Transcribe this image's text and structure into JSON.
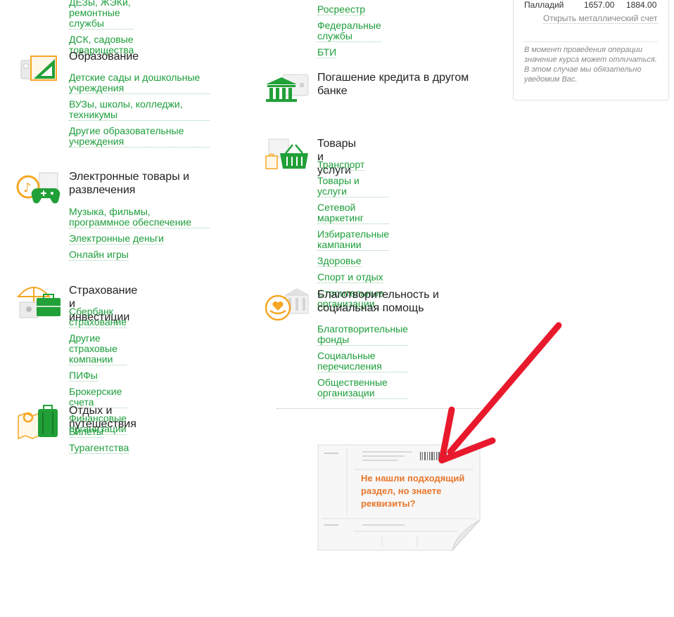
{
  "left_column": [
    {
      "title": "",
      "icon": "home-services-icon",
      "links": [
        "ДЕЗы, ЖЭКи, ремонтные службы",
        "ДСК, садовые товарищества"
      ]
    },
    {
      "title": "Образование",
      "icon": "education-icon",
      "links": [
        "Детские сады и дошкольные учреждения",
        "ВУЗы, школы, колледжи, техникумы",
        "Другие образовательные учреждения"
      ]
    },
    {
      "title": "Электронные товары и развлечения",
      "icon": "entertainment-icon",
      "links": [
        "Музыка, фильмы, программное обеспечение",
        "Электронные деньги",
        "Онлайн игры"
      ]
    },
    {
      "title": "Страхование и инвестиции",
      "icon": "insurance-icon",
      "links": [
        "Сбербанк страхование",
        "Другие страховые компании",
        "ПИФы",
        "Брокерские счета",
        "Финансовые организации"
      ]
    },
    {
      "title": "Отдых и путешествия",
      "icon": "travel-icon",
      "links": [
        "Билеты",
        "Турагентства"
      ]
    }
  ],
  "right_column": [
    {
      "title": "",
      "icon": "government-icon",
      "links": [
        "Росреестр",
        "Федеральные службы",
        "БТИ"
      ]
    },
    {
      "title": "Погашение кредита в другом банке",
      "icon": "bank-icon",
      "links": []
    },
    {
      "title": "Товары и услуги",
      "icon": "shopping-basket-icon",
      "links": [
        "Транспорт",
        "Товары и услуги",
        "Сетевой маркетинг",
        "Избирательные кампании",
        "Здоровье",
        "Спорт и отдых",
        "Строительные организации"
      ]
    },
    {
      "title": "Благотворительность и социальная помощь",
      "icon": "charity-icon",
      "links": [
        "Благотворительные фонды",
        "Социальные перечисления",
        "Общественные организации"
      ]
    }
  ],
  "metals_panel": {
    "row": {
      "name": "Палладий",
      "buy": "1657.00",
      "sell": "1884.00"
    },
    "open_account": "Открыть металлический счет",
    "note": "В момент проведения операции значение курса может отличаться. В этом случае мы обязательно уведомим Вас."
  },
  "receipt": {
    "text": "Не нашли подходящий раздел, но знаете реквизиты?"
  },
  "colors": {
    "link": "#1c9e3a",
    "icon_green": "#21a038",
    "icon_orange": "#f5a623",
    "receipt_text": "#e8762a",
    "arrow": "#e8192c"
  }
}
